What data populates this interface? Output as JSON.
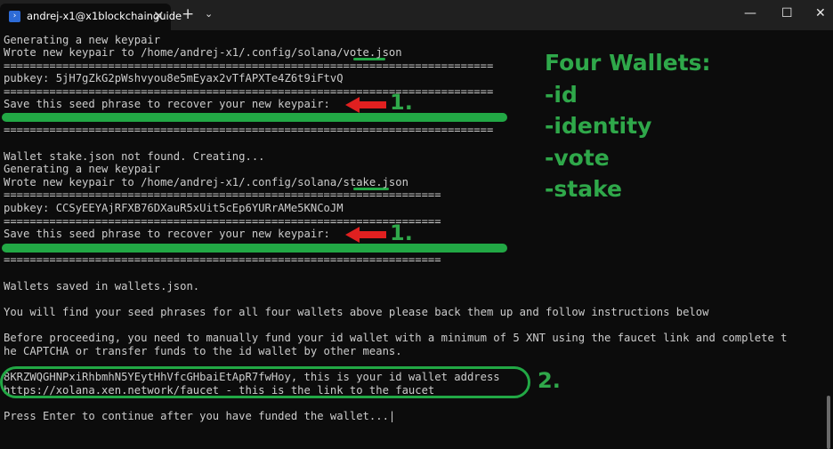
{
  "window": {
    "tab_title": "andrej-x1@x1blockchainguide",
    "tab_icon_glyph": "›",
    "new_tab_glyph": "+",
    "dropdown_glyph": "⌄",
    "minimize_glyph": "—",
    "maximize_glyph": "☐",
    "close_glyph": "✕",
    "tab_close_glyph": "✕"
  },
  "terminal": {
    "lines": [
      "Generating a new keypair",
      "Wrote new keypair to /home/andrej-x1/.config/solana/vote.json",
      "===========================================================================",
      "pubkey: 5jH7gZkG2pWshvyou8e5mEyax2vTfAPXTe4Z6t9iFtvQ",
      "===========================================================================",
      "Save this seed phrase to recover your new keypair:",
      "",
      "===========================================================================",
      "",
      "Wallet stake.json not found. Creating...",
      "Generating a new keypair",
      "Wrote new keypair to /home/andrej-x1/.config/solana/stake.json",
      "===================================================================",
      "pubkey: CCSyEEYAjRFXB76DXauR5xUit5cEp6YURrAMe5KNCoJM",
      "===================================================================",
      "Save this seed phrase to recover your new keypair:",
      "",
      "===================================================================",
      "",
      "Wallets saved in wallets.json.",
      "",
      "You will find your seed phrases for all four wallets above please back them up and follow instructions below",
      "",
      "Before proceeding, you need to manually fund your id wallet with a minimum of 5 XNT using the faucet link and complete t",
      "he CAPTCHA or transfer funds to the id wallet by other means.",
      "",
      "8KRZWQGHNPxiRhbmhN5YEytHhVfcGHbaiEtApR7fwHoy, this is your id wallet address",
      "https://xolana.xen.network/faucet - this is the link to the faucet",
      "",
      "Press Enter to continue after you have funded the wallet..."
    ],
    "cursor": "|"
  },
  "annotations": {
    "step1": "1.",
    "step1b": "1.",
    "step2": "2.",
    "arrow_color": "#e02020",
    "highlight_color": "#22a845"
  },
  "wallets_panel": {
    "title": "Four Wallets:",
    "items": [
      "-id",
      "-identity",
      "-vote",
      "-stake"
    ]
  }
}
